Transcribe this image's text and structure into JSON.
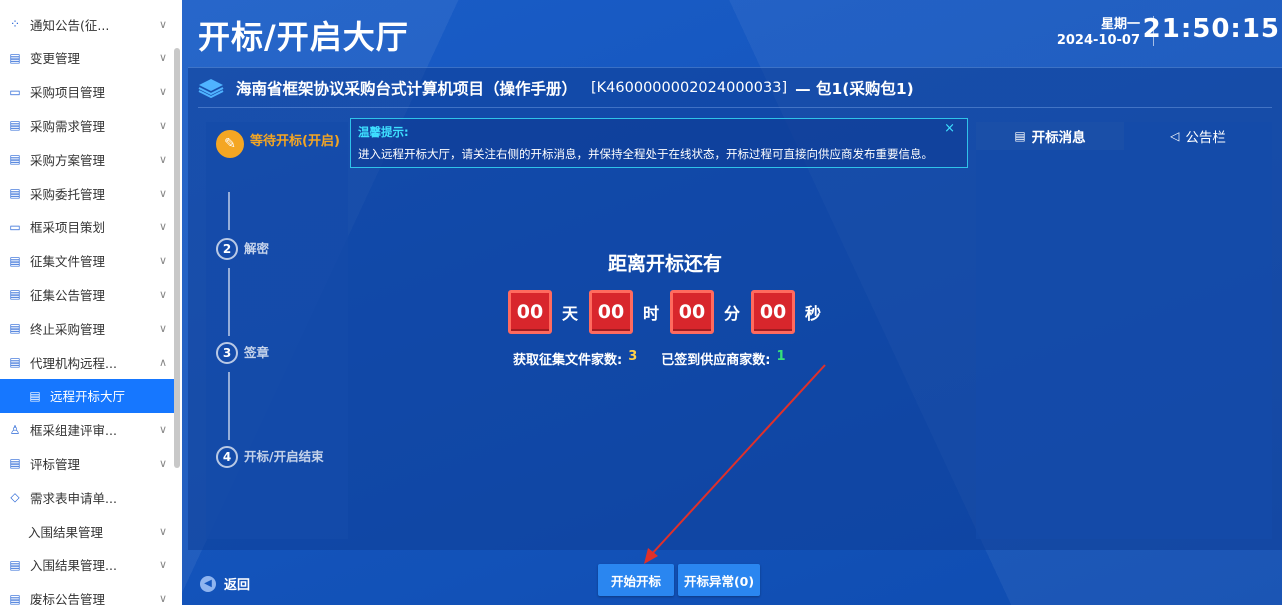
{
  "sidebar": {
    "items": [
      {
        "icon": "grid-icon",
        "label": "通知公告(征...",
        "chev": "∨"
      },
      {
        "icon": "doc-icon",
        "label": "变更管理",
        "chev": "∨"
      },
      {
        "icon": "folder-icon",
        "label": "采购项目管理",
        "chev": "∨"
      },
      {
        "icon": "doc-icon",
        "label": "采购需求管理",
        "chev": "∨"
      },
      {
        "icon": "doc-icon",
        "label": "采购方案管理",
        "chev": "∨"
      },
      {
        "icon": "doc-icon",
        "label": "采购委托管理",
        "chev": "∨"
      },
      {
        "icon": "folder-icon",
        "label": "框采项目策划",
        "chev": "∨"
      },
      {
        "icon": "doc-icon",
        "label": "征集文件管理",
        "chev": "∨"
      },
      {
        "icon": "doc-icon",
        "label": "征集公告管理",
        "chev": "∨"
      },
      {
        "icon": "doc-icon",
        "label": "终止采购管理",
        "chev": "∨"
      },
      {
        "icon": "doc-icon",
        "label": "代理机构远程...",
        "chev": "∧"
      },
      {
        "icon": "doc-icon",
        "label": "远程开标大厅",
        "chev": "",
        "active": true,
        "sub": true
      },
      {
        "icon": "user-icon",
        "label": "框采组建评审...",
        "chev": "∨"
      },
      {
        "icon": "doc-icon",
        "label": "评标管理",
        "chev": "∨"
      },
      {
        "icon": "diamond-icon",
        "label": "需求表申请单...",
        "chev": ""
      },
      {
        "icon": "",
        "label": "入围结果管理",
        "chev": "∨",
        "sub": true
      },
      {
        "icon": "doc-icon",
        "label": "入围结果管理...",
        "chev": "∨"
      },
      {
        "icon": "doc-icon",
        "label": "废标公告管理",
        "chev": "∨"
      }
    ]
  },
  "header": {
    "title": "开标/开启大厅",
    "weekday": "星期一",
    "date": "2024-10-07",
    "time": "21:50:15"
  },
  "project": {
    "name": "海南省框架协议采购台式计算机项目（操作手册）",
    "code": "[K4600000002024000033]",
    "package": "— 包1(采购包1)"
  },
  "steps": [
    {
      "num": "✎",
      "label": "等待开标(开启)",
      "current": true
    },
    {
      "num": "2",
      "label": "解密"
    },
    {
      "num": "3",
      "label": "签章"
    },
    {
      "num": "4",
      "label": "开标/开启结束"
    }
  ],
  "tip": {
    "title": "温馨提示:",
    "text": "进入远程开标大厅，请关注右侧的开标消息，并保持全程处于在线状态，开标过程可直接向供应商发布重要信息。",
    "close": "×"
  },
  "countdown": {
    "title": "距离开标还有",
    "days": "00",
    "days_unit": "天",
    "hours": "00",
    "hours_unit": "时",
    "minutes": "00",
    "minutes_unit": "分",
    "seconds": "00",
    "seconds_unit": "秒"
  },
  "stats": {
    "files_label": "获取征集文件家数:",
    "files_value": "3",
    "signed_label": "已签到供应商家数:",
    "signed_value": "1"
  },
  "messages": {
    "tab_messages": "开标消息",
    "tab_notice": "公告栏"
  },
  "footer": {
    "back": "返回",
    "start_button": "开始开标",
    "abnormal_button": "开标异常(0)"
  },
  "colors": {
    "accent": "#1677ff",
    "step_current": "#f4a623",
    "countdown_box": "#d8262c",
    "tip_border": "#2fc3ea",
    "annotation_arrow": "#e0302a"
  }
}
